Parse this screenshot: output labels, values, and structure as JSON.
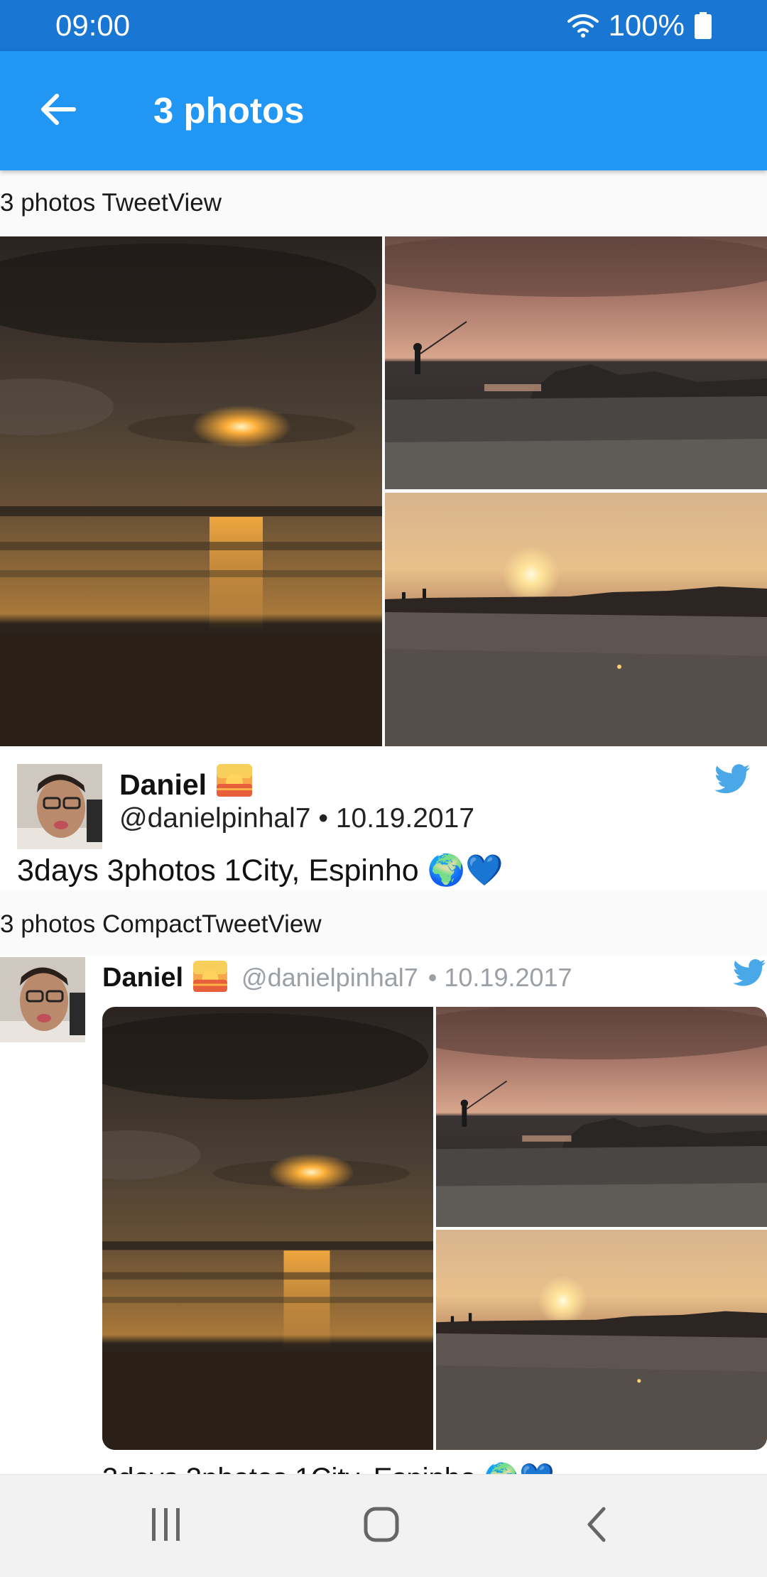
{
  "status_bar": {
    "time": "09:00",
    "battery": "100%",
    "icons": [
      "wifi-icon",
      "battery-icon"
    ]
  },
  "app_bar": {
    "title": "3 photos",
    "back_icon": "arrow-back-icon"
  },
  "sections": {
    "tweet_view_label": "3 photos TweetView",
    "compact_view_label": "3 photos CompactTweetView"
  },
  "tweet": {
    "name": "Daniel",
    "name_emoji": "sunset-emoji",
    "handle": "@danielpinhal7",
    "separator": "•",
    "date": "10.19.2017",
    "text": "3days 3photos 1City, Espinho 🌍💙",
    "photos": [
      "sunset-over-beach",
      "fisherman-on-rocks",
      "sunset-over-pier"
    ],
    "brand_icon": "twitter-bird-icon"
  },
  "navigation": {
    "buttons": [
      "recent-apps-icon",
      "home-icon",
      "back-icon"
    ]
  },
  "colors": {
    "status_bar": "#1976d2",
    "app_bar": "#2196f3",
    "twitter_blue": "#1da1f2"
  }
}
